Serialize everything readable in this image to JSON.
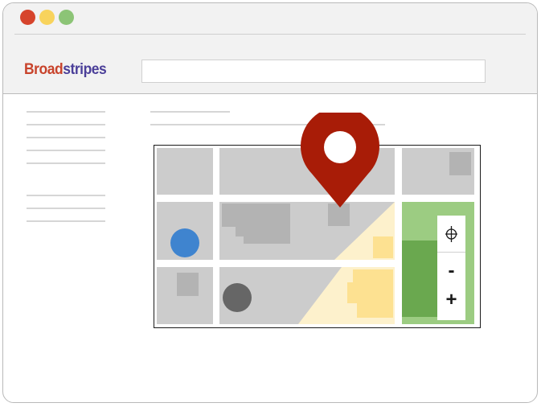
{
  "app": {
    "logo_part1": "Broad",
    "logo_part2": "stripes",
    "logo_color1": "#c8432b",
    "logo_color2": "#4b3f99"
  },
  "window_controls": {
    "close_color": "#d6442c",
    "minimize_color": "#f8d35c",
    "maximize_color": "#8cc476"
  },
  "search": {
    "value": "",
    "placeholder": ""
  },
  "map": {
    "pin_color": "#a81c07",
    "marker_blue_color": "#3f84cf",
    "marker_gray_color": "#666666",
    "park_color": "#8cc476",
    "zoom_in_label": "+",
    "zoom_out_label": "-",
    "locate_icon": "crosshair-globe-icon"
  }
}
